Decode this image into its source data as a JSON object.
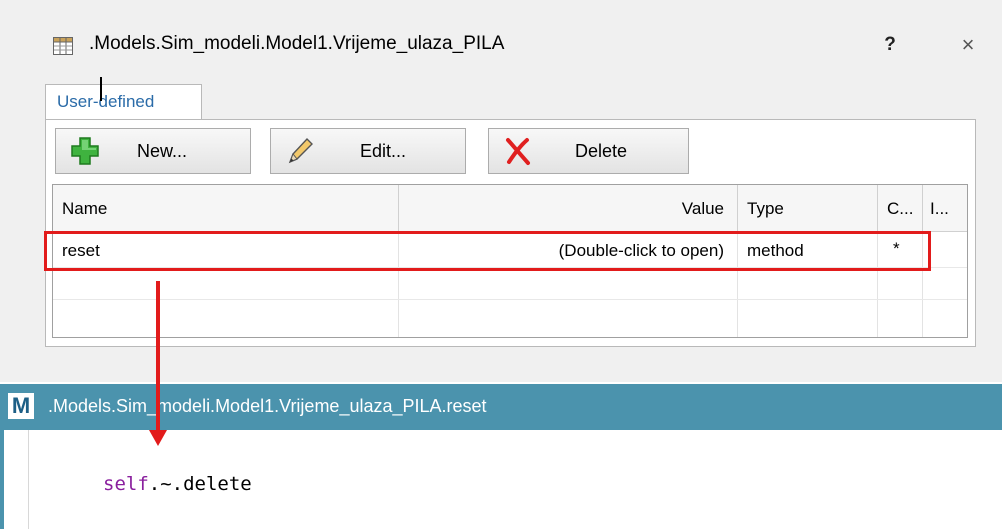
{
  "dialog": {
    "title": ".Models.Sim_modeli.Model1.Vrijeme_ulaza_PILA",
    "help_label": "?",
    "close_label": "×",
    "tab_label": "User-defined",
    "toolbar": {
      "new_label": "New...",
      "edit_label": "Edit...",
      "delete_label": "Delete"
    },
    "table": {
      "headers": [
        "Name",
        "Value",
        "Type",
        "C...",
        "I..."
      ],
      "rows": [
        {
          "name": "reset",
          "value": "(Double-click to open)",
          "type": "method",
          "c": "*",
          "i": ""
        }
      ]
    }
  },
  "editor": {
    "icon_letter": "M",
    "title": ".Models.Sim_modeli.Model1.Vrijeme_ulaza_PILA.reset",
    "code": {
      "keyword": "self",
      "rest": ".~.delete"
    }
  },
  "colors": {
    "highlight": "#e21b1b",
    "editor_titlebar": "#4b93ad",
    "tab_text": "#2a6ba8",
    "keyword": "#8a1f9e"
  },
  "icons": {
    "dialog": "table-grid-icon",
    "new": "green-plus-icon",
    "edit": "pencil-icon",
    "delete": "red-x-icon"
  }
}
